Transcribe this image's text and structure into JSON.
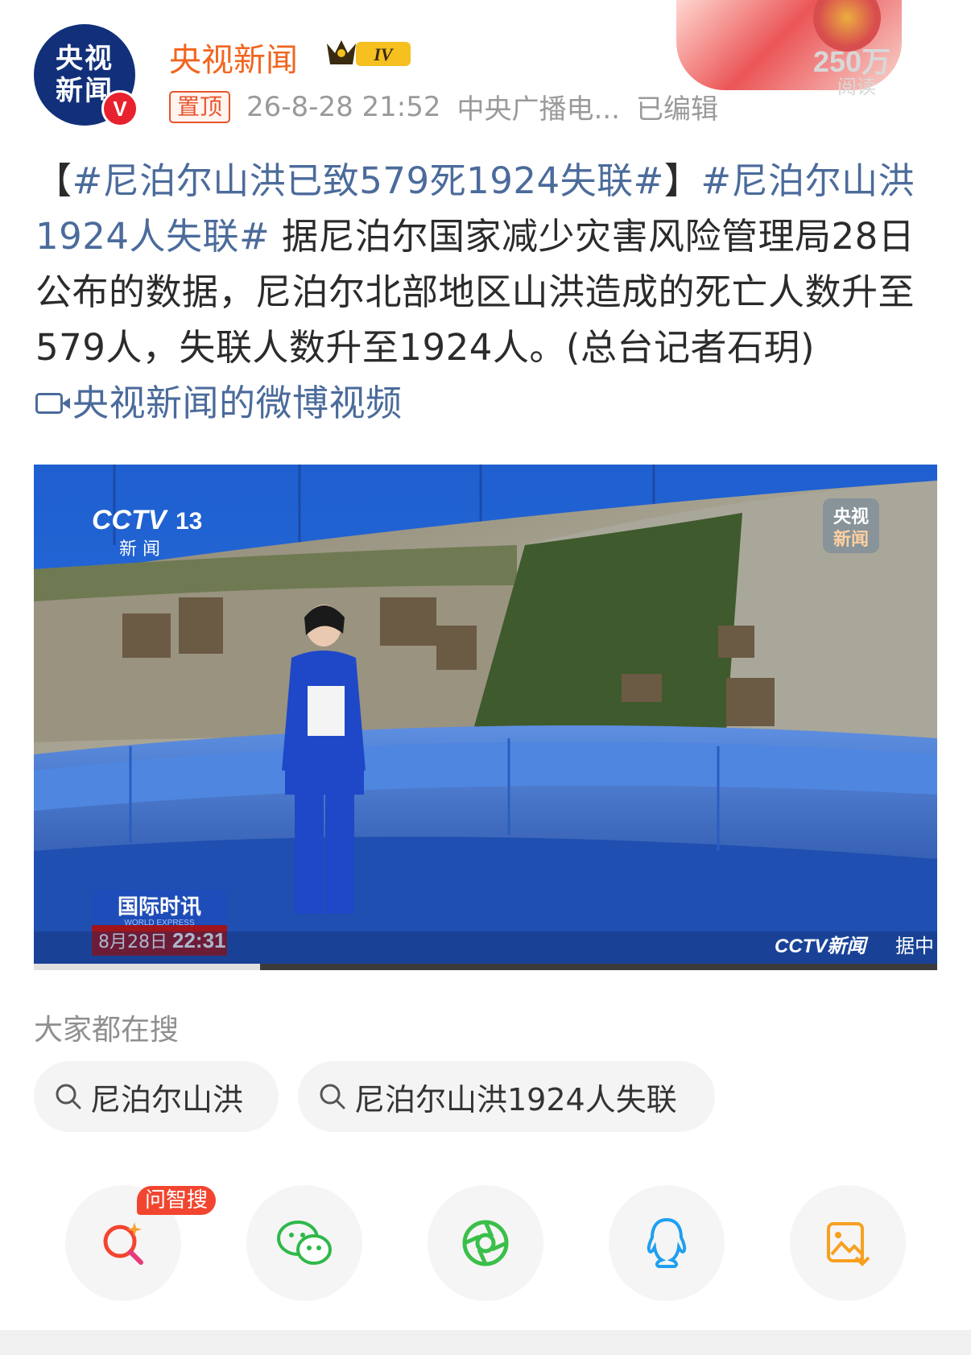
{
  "account": {
    "avatar_line1": "央视",
    "avatar_line2": "新闻",
    "verified_mark": "V",
    "name": "央视新闻",
    "level_badge": "IV",
    "pinned_label": "置顶",
    "timestamp": "26-8-28 21:52",
    "source": "中央广播电...",
    "edited_label": "已编辑",
    "read_count": "250万",
    "read_label": "阅读"
  },
  "post": {
    "bracket_open": "【",
    "tag1": "#尼泊尔山洪已致579死1924失联#",
    "bracket_close": "】",
    "tag2": "#尼泊尔山洪1924人失联#",
    "body": "据尼泊尔国家减少灾害风险管理局28日公布的数据，尼泊尔北部地区山洪造成的死亡人数升至579人，失联人数升至1924人。(总台记者石玥)",
    "video_link": "央视新闻的微博视频"
  },
  "video": {
    "channel_logo": "CCTV",
    "channel_number": "13",
    "channel_sub": "新 闻",
    "corner_logo_line1": "央视",
    "corner_logo_line2": "新闻",
    "program_name": "国际时讯",
    "program_sub": "WORLD EXPRESS",
    "date": "8月28日",
    "time": "22:31",
    "bottom_brand": "CCTV新闻",
    "bottom_text": "据中",
    "progress_fraction": 0.25
  },
  "search": {
    "title": "大家都在搜",
    "chips": [
      "尼泊尔山洪",
      "尼泊尔山洪1924人失联"
    ]
  },
  "actions": {
    "ai_badge": "问智搜",
    "icons": [
      "ai-search-icon",
      "wechat-icon",
      "moments-icon",
      "qq-icon",
      "save-image-icon"
    ]
  },
  "colors": {
    "brand_orange": "#f2651f",
    "link_blue": "#4b6b9b",
    "badge_red": "#f2452f"
  }
}
